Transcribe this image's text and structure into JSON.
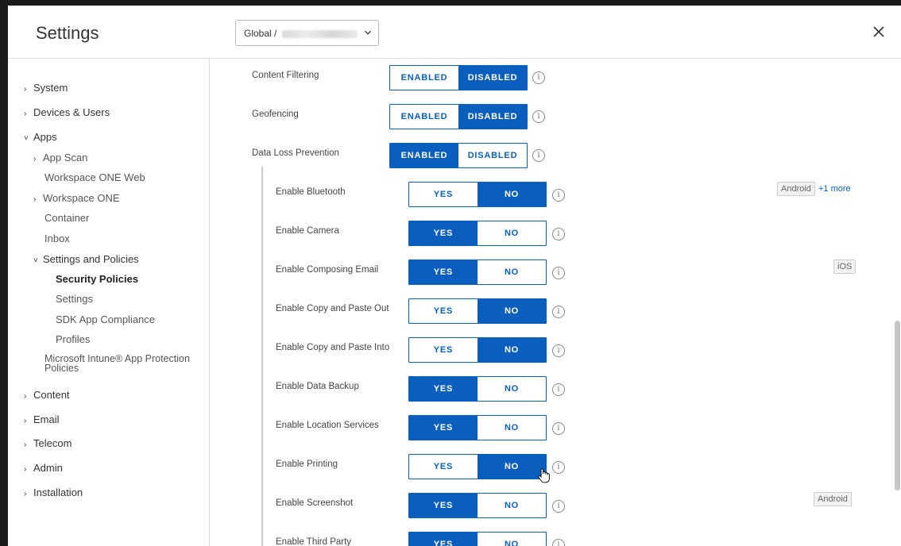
{
  "header": {
    "title": "Settings",
    "scope_label": "Global /",
    "close_icon": "close-icon"
  },
  "sidebar": {
    "items": [
      {
        "label": "System",
        "chevron": "›"
      },
      {
        "label": "Devices & Users",
        "chevron": "›"
      },
      {
        "label": "Apps",
        "chevron": "˅"
      },
      {
        "label": "App Scan",
        "chevron": "›"
      },
      {
        "label": "Workspace ONE Web",
        "chevron": ""
      },
      {
        "label": "Workspace ONE",
        "chevron": "›"
      },
      {
        "label": "Container",
        "chevron": ""
      },
      {
        "label": "Inbox",
        "chevron": ""
      },
      {
        "label": "Settings and Policies",
        "chevron": "˅"
      },
      {
        "label": "Security Policies",
        "chevron": ""
      },
      {
        "label": "Settings",
        "chevron": ""
      },
      {
        "label": "SDK App Compliance",
        "chevron": ""
      },
      {
        "label": "Profiles",
        "chevron": ""
      },
      {
        "label": "Microsoft Intune® App Protection",
        "chevron": ""
      },
      {
        "label": "Policies",
        "chevron": ""
      },
      {
        "label": "Content",
        "chevron": "›"
      },
      {
        "label": "Email",
        "chevron": "›"
      },
      {
        "label": "Telecom",
        "chevron": "›"
      },
      {
        "label": "Admin",
        "chevron": "›"
      },
      {
        "label": "Installation",
        "chevron": "›"
      }
    ]
  },
  "policies": {
    "top": [
      {
        "label": "Content Filtering",
        "on": "ENABLED",
        "off": "DISABLED",
        "selected": "DISABLED"
      },
      {
        "label": "Geofencing",
        "on": "ENABLED",
        "off": "DISABLED",
        "selected": "DISABLED"
      },
      {
        "label": "Data Loss Prevention",
        "on": "ENABLED",
        "off": "DISABLED",
        "selected": "ENABLED"
      }
    ],
    "dlp": [
      {
        "label": "Enable Bluetooth",
        "on": "YES",
        "off": "NO",
        "selected": "NO",
        "badge": "Android",
        "more": "+1 more"
      },
      {
        "label": "Enable Camera",
        "on": "YES",
        "off": "NO",
        "selected": "YES"
      },
      {
        "label": "Enable Composing Email",
        "on": "YES",
        "off": "NO",
        "selected": "YES",
        "badge": "iOS"
      },
      {
        "label": "Enable Copy and Paste Out",
        "on": "YES",
        "off": "NO",
        "selected": "NO"
      },
      {
        "label": "Enable Copy and Paste Into",
        "on": "YES",
        "off": "NO",
        "selected": "NO"
      },
      {
        "label": "Enable Data Backup",
        "on": "YES",
        "off": "NO",
        "selected": "YES"
      },
      {
        "label": "Enable Location Services",
        "on": "YES",
        "off": "NO",
        "selected": "YES"
      },
      {
        "label": "Enable Printing",
        "on": "YES",
        "off": "NO",
        "selected": "NO"
      },
      {
        "label": "Enable Screenshot",
        "on": "YES",
        "off": "NO",
        "selected": "YES",
        "badge": "Android"
      },
      {
        "label": "Enable Third Party",
        "on": "YES",
        "off": "NO",
        "selected": "YES"
      }
    ]
  },
  "colors": {
    "accent": "#0a5ebd",
    "backdrop": "#1a1a1a"
  }
}
